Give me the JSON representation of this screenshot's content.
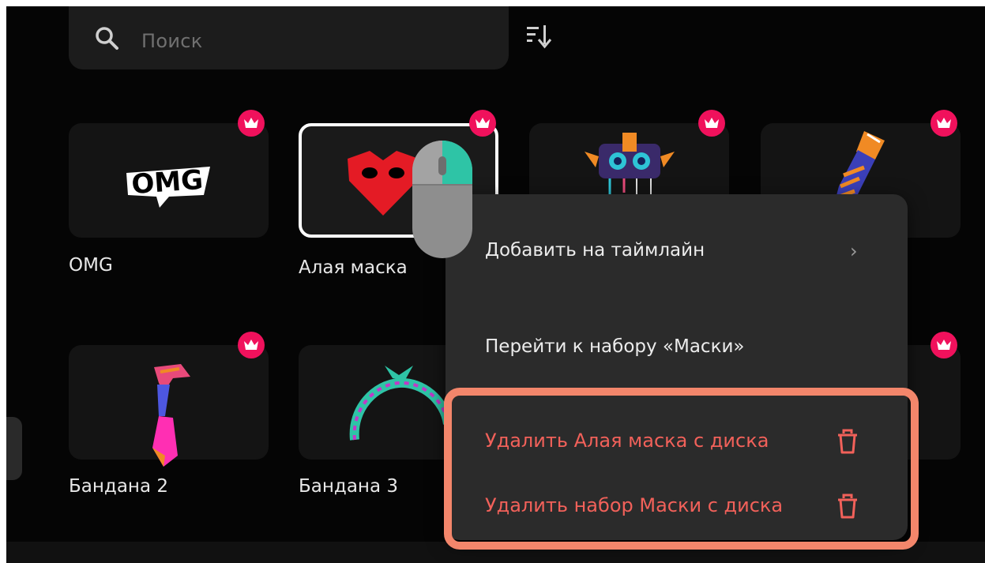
{
  "search": {
    "placeholder": "Поиск"
  },
  "grid": {
    "items": [
      {
        "name": "OMG",
        "icon": "omg-sticker-icon"
      },
      {
        "name": "Алая маска",
        "icon": "red-mask-icon",
        "selected": true
      },
      {
        "name": "",
        "icon": "robot-mask-icon"
      },
      {
        "name": "",
        "icon": "bandana-icon"
      },
      {
        "name": "Бандана 2",
        "icon": "bandana-tie-icon"
      },
      {
        "name": "Бандана 3",
        "icon": "headband-icon"
      }
    ]
  },
  "context_menu": {
    "add_to_timeline": "Добавить на таймлайн",
    "go_to_set": "Перейти к набору «Маски»",
    "delete_item": "Удалить Алая маска с диска",
    "delete_set": "Удалить набор Маски с диска"
  },
  "colors": {
    "premium_badge": "#f0115c",
    "danger_text": "#f2615a",
    "highlight_outline": "#f3866b",
    "mouse_button_accent": "#2ec4a6"
  }
}
